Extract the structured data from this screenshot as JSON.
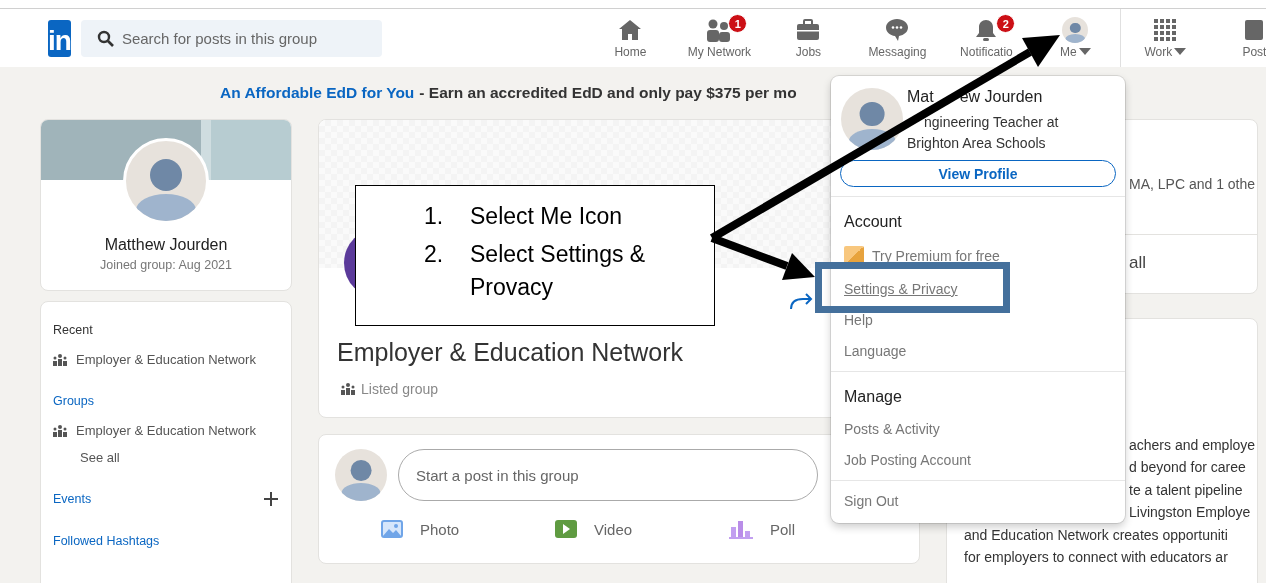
{
  "nav": {
    "logo": "in",
    "search": {
      "placeholder": "Search for posts in this group"
    },
    "items": [
      {
        "label": "Home",
        "kind": "home"
      },
      {
        "label": "My Network",
        "kind": "network",
        "badge": "1"
      },
      {
        "label": "Jobs",
        "kind": "jobs"
      },
      {
        "label": "Messaging",
        "kind": "messaging"
      },
      {
        "label": "Notificatio",
        "kind": "notifications",
        "badge": "2"
      },
      {
        "label": "Me",
        "kind": "me",
        "caret": true
      },
      {
        "label": "Work",
        "kind": "work",
        "caret": true
      },
      {
        "label": "Post",
        "kind": "post",
        "caret": false
      }
    ]
  },
  "ad": {
    "link": "An Affordable EdD for You",
    "text": "- Earn an accredited EdD and only pay $375 per mo"
  },
  "profile_card": {
    "name": "Matthew Jourden",
    "joined": "Joined group: Aug 2021"
  },
  "sidebar": {
    "sections": [
      {
        "title": "Recent",
        "kind": "plain",
        "items": [
          "Employer & Education Network"
        ],
        "add": false
      },
      {
        "title": "Groups",
        "kind": "link",
        "items": [
          "Employer & Education Network"
        ],
        "see_all": "See all",
        "add": false
      },
      {
        "title": "Events",
        "kind": "link",
        "add": true
      },
      {
        "title": "Followed Hashtags",
        "kind": "link",
        "add": false
      }
    ]
  },
  "group": {
    "name": "Employer & Education Network",
    "visibility": "Listed group"
  },
  "composer": {
    "placeholder": "Start a post in this group",
    "actions": [
      {
        "label": "Photo",
        "kind": "photo"
      },
      {
        "label": "Video",
        "kind": "video"
      },
      {
        "label": "Poll",
        "kind": "poll"
      }
    ]
  },
  "right_panel": {
    "members_note": "MA, LPC and 1 othe",
    "see_all": "all",
    "about_lines": [
      {
        "text": "achers and employe",
        "kind": "beside_menu"
      },
      {
        "text": "d beyond for caree",
        "kind": "beside_menu"
      },
      {
        "text": "te a talent pipeline",
        "kind": "beside_menu"
      },
      {
        "text": "Livingston Employe",
        "kind": "beside_menu"
      },
      {
        "text": "and Education Network creates opportuniti",
        "kind": "full"
      },
      {
        "text": "for employers to connect with educators ar",
        "kind": "full"
      }
    ]
  },
  "me_menu": {
    "name_parts": [
      "Mat",
      "ew Jourden"
    ],
    "headline": "ngineering Teacher at Brighton Area Schools",
    "view_profile": "View Profile",
    "sections": [
      {
        "title": "Account",
        "items": [
          {
            "label": "Try Premium for free",
            "kind": "premium"
          },
          {
            "label": "Settings & Privacy",
            "kind": "link",
            "hovered": true
          },
          {
            "label": "Help",
            "kind": "link",
            "hovered": false
          },
          {
            "label": "Language",
            "kind": "link",
            "hovered": false
          }
        ]
      },
      {
        "title": "Manage",
        "items": [
          {
            "label": "Posts & Activity",
            "kind": "link",
            "hovered": false
          },
          {
            "label": "Job Posting Account",
            "kind": "link",
            "hovered": false
          }
        ]
      }
    ],
    "sign_out": "Sign Out"
  },
  "annotation": {
    "steps": [
      {
        "number": "1.",
        "text": "Select Me Icon"
      },
      {
        "number": "2.",
        "text": "Select Settings & Provacy"
      }
    ]
  }
}
